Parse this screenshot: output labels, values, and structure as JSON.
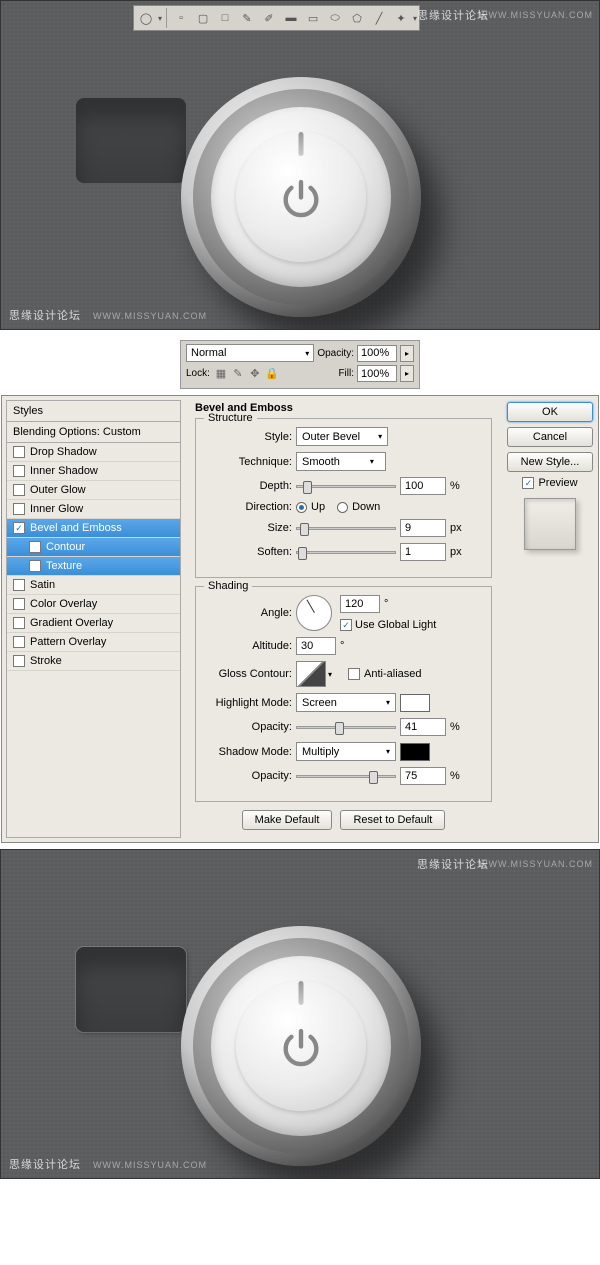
{
  "watermark": {
    "text_cn": "思缘设计论坛",
    "url": "WWW.MISSYUAN.COM"
  },
  "toolbar": {
    "tools": [
      "ellipse",
      "rect",
      "rounded-rect",
      "line",
      "pen",
      "freeform",
      "rectangle",
      "rounded",
      "ellipse2",
      "polygon",
      "custom"
    ]
  },
  "layers": {
    "blend_label": "",
    "blend_mode": "Normal",
    "opacity_label": "Opacity:",
    "opacity_value": "100%",
    "lock_label": "Lock:",
    "fill_label": "Fill:",
    "fill_value": "100%"
  },
  "styles_panel": {
    "header": "Styles",
    "blending": "Blending Options: Custom",
    "items": [
      {
        "label": "Drop Shadow",
        "checked": false
      },
      {
        "label": "Inner Shadow",
        "checked": false
      },
      {
        "label": "Outer Glow",
        "checked": false
      },
      {
        "label": "Inner Glow",
        "checked": false
      },
      {
        "label": "Bevel and Emboss",
        "checked": true,
        "selected": true
      },
      {
        "label": "Contour",
        "checked": false,
        "sub": true,
        "selected": true
      },
      {
        "label": "Texture",
        "checked": false,
        "sub": true,
        "selected": true
      },
      {
        "label": "Satin",
        "checked": false
      },
      {
        "label": "Color Overlay",
        "checked": false
      },
      {
        "label": "Gradient Overlay",
        "checked": false
      },
      {
        "label": "Pattern Overlay",
        "checked": false
      },
      {
        "label": "Stroke",
        "checked": false
      }
    ]
  },
  "settings": {
    "title": "Bevel and Emboss",
    "structure": {
      "legend": "Structure",
      "style_label": "Style:",
      "style_value": "Outer Bevel",
      "technique_label": "Technique:",
      "technique_value": "Smooth",
      "depth_label": "Depth:",
      "depth_value": "100",
      "depth_unit": "%",
      "direction_label": "Direction:",
      "up": "Up",
      "down": "Down",
      "size_label": "Size:",
      "size_value": "9",
      "size_unit": "px",
      "soften_label": "Soften:",
      "soften_value": "1",
      "soften_unit": "px"
    },
    "shading": {
      "legend": "Shading",
      "angle_label": "Angle:",
      "angle_value": "120",
      "angle_unit": "°",
      "global_light": "Use Global Light",
      "altitude_label": "Altitude:",
      "altitude_value": "30",
      "altitude_unit": "°",
      "gloss_label": "Gloss Contour:",
      "antialiased": "Anti-aliased",
      "highlight_label": "Highlight Mode:",
      "highlight_value": "Screen",
      "highlight_color": "#ffffff",
      "h_opacity_label": "Opacity:",
      "h_opacity_value": "41",
      "h_opacity_unit": "%",
      "shadow_label": "Shadow Mode:",
      "shadow_value": "Multiply",
      "shadow_color": "#000000",
      "s_opacity_label": "Opacity:",
      "s_opacity_value": "75",
      "s_opacity_unit": "%"
    },
    "make_default": "Make Default",
    "reset_default": "Reset to Default"
  },
  "right": {
    "ok": "OK",
    "cancel": "Cancel",
    "new_style": "New Style...",
    "preview": "Preview"
  }
}
